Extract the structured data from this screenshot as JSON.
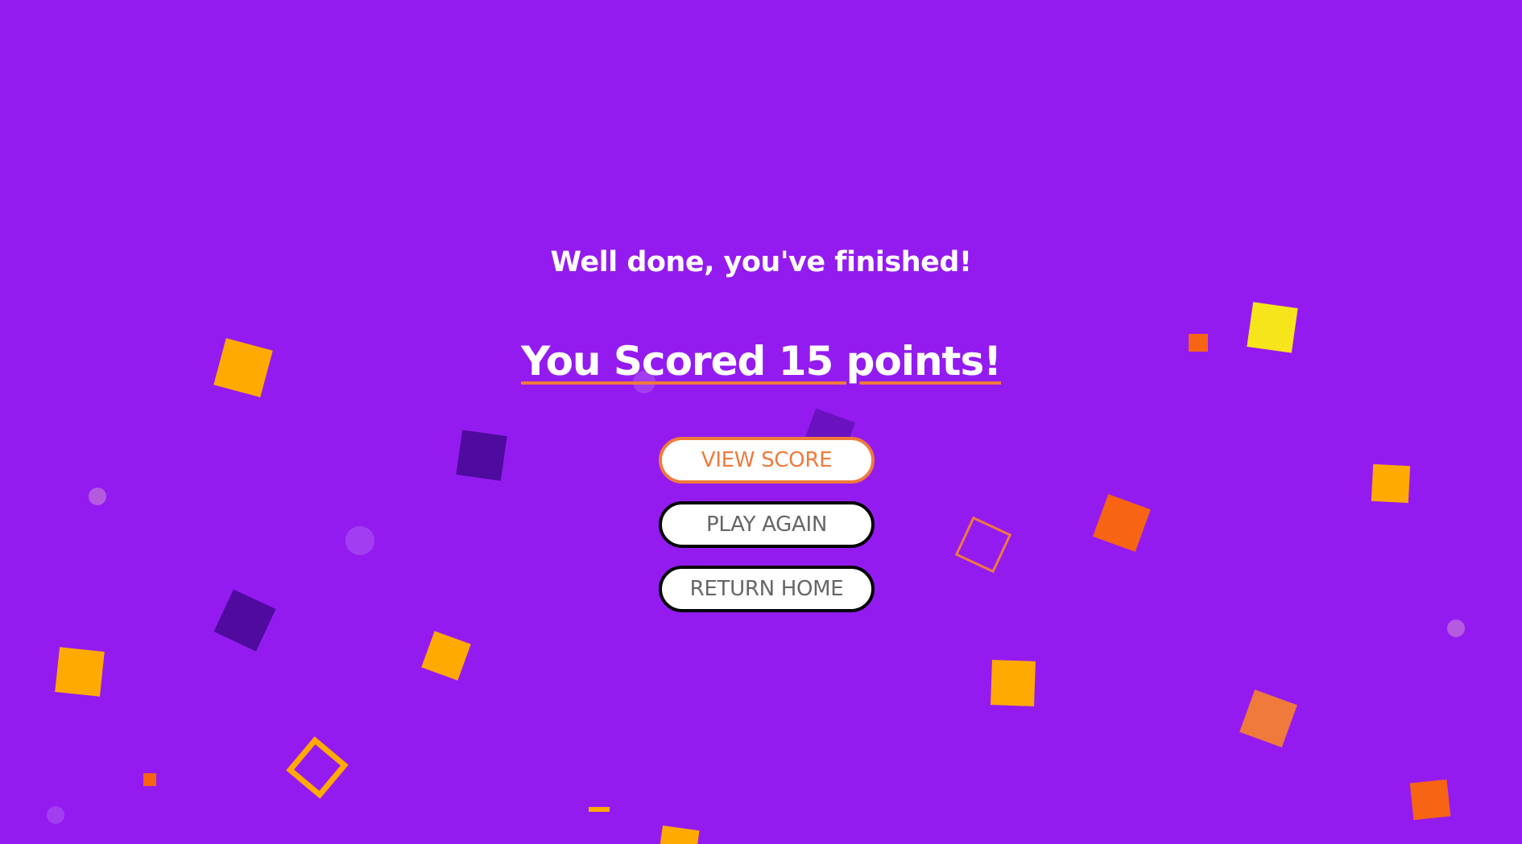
{
  "screen": {
    "subtitle": "Well done, you've finished!",
    "score_text": "You Scored 15 points!"
  },
  "buttons": {
    "view_score": "VIEW SCORE",
    "play_again": "PLAY AGAIN",
    "return_home": "RETURN HOME"
  },
  "colors": {
    "background": "#941bf0",
    "accent": "#ef7a3c",
    "text": "#ffffff",
    "button_text": "#666666",
    "confetti_orange": "#ffaa00",
    "confetti_red_orange": "#f66414",
    "confetti_yellow": "#f7e51c",
    "confetti_dark_purple": "#4e0b9e",
    "confetti_salmon": "#ef7a3c"
  }
}
